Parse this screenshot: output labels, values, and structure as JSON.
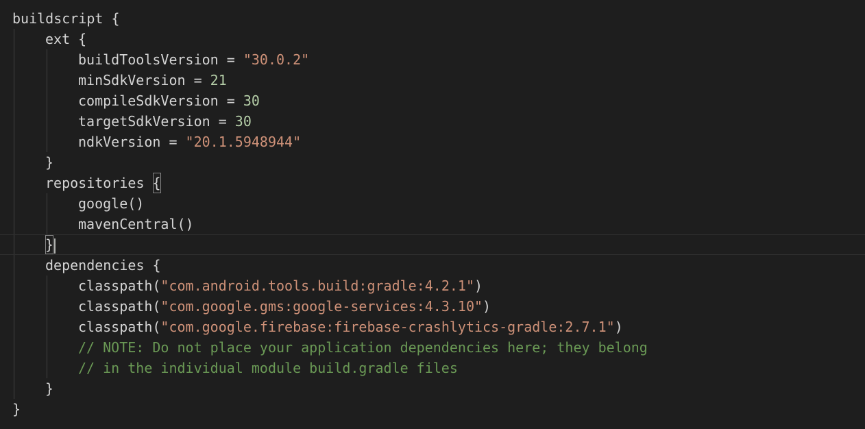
{
  "editor": {
    "lines": [
      {
        "id": "l1",
        "tokens": [
          {
            "t": "buildscript {",
            "k": "plain"
          }
        ]
      },
      {
        "id": "l2",
        "tokens": [
          {
            "t": "ext {",
            "k": "plain"
          }
        ]
      },
      {
        "id": "l3",
        "tokens": [
          {
            "t": "buildToolsVersion = ",
            "k": "plain"
          },
          {
            "t": "\"30.0.2\"",
            "k": "str"
          }
        ]
      },
      {
        "id": "l4",
        "tokens": [
          {
            "t": "minSdkVersion = ",
            "k": "plain"
          },
          {
            "t": "21",
            "k": "num"
          }
        ]
      },
      {
        "id": "l5",
        "tokens": [
          {
            "t": "compileSdkVersion = ",
            "k": "plain"
          },
          {
            "t": "30",
            "k": "num"
          }
        ]
      },
      {
        "id": "l6",
        "tokens": [
          {
            "t": "targetSdkVersion = ",
            "k": "plain"
          },
          {
            "t": "30",
            "k": "num"
          }
        ]
      },
      {
        "id": "l7",
        "tokens": [
          {
            "t": "ndkVersion = ",
            "k": "plain"
          },
          {
            "t": "\"20.1.5948944\"",
            "k": "str"
          }
        ]
      },
      {
        "id": "l8",
        "tokens": [
          {
            "t": "}",
            "k": "plain"
          }
        ]
      },
      {
        "id": "l9",
        "tokens": [
          {
            "t": "repositories ",
            "k": "plain"
          },
          {
            "t": "{",
            "k": "bracket"
          }
        ]
      },
      {
        "id": "l10",
        "tokens": [
          {
            "t": "google()",
            "k": "plain"
          }
        ]
      },
      {
        "id": "l11",
        "tokens": [
          {
            "t": "mavenCentral()",
            "k": "plain"
          }
        ]
      },
      {
        "id": "l12",
        "tokens": [
          {
            "t": "}",
            "k": "bracket"
          }
        ]
      },
      {
        "id": "l13",
        "tokens": [
          {
            "t": "dependencies {",
            "k": "plain"
          }
        ]
      },
      {
        "id": "l14",
        "tokens": [
          {
            "t": "classpath(",
            "k": "plain"
          },
          {
            "t": "\"com.android.tools.build:gradle:4.2.1\"",
            "k": "str"
          },
          {
            "t": ")",
            "k": "plain"
          }
        ]
      },
      {
        "id": "l15",
        "tokens": [
          {
            "t": "classpath(",
            "k": "plain"
          },
          {
            "t": "\"com.google.gms:google-services:4.3.10\"",
            "k": "str"
          },
          {
            "t": ")",
            "k": "plain"
          }
        ]
      },
      {
        "id": "l16",
        "tokens": [
          {
            "t": "classpath(",
            "k": "plain"
          },
          {
            "t": "\"com.google.firebase:firebase-crashlytics-gradle:2.7.1\"",
            "k": "str"
          },
          {
            "t": ")",
            "k": "plain"
          }
        ]
      },
      {
        "id": "l17",
        "tokens": [
          {
            "t": "// NOTE: Do not place your application dependencies here; they belong",
            "k": "cmt"
          }
        ]
      },
      {
        "id": "l18",
        "tokens": [
          {
            "t": "// in the individual module build.gradle files",
            "k": "cmt"
          }
        ]
      },
      {
        "id": "l19",
        "tokens": [
          {
            "t": "}",
            "k": "plain"
          }
        ]
      },
      {
        "id": "l20",
        "tokens": [
          {
            "t": "}",
            "k": "plain"
          }
        ]
      }
    ]
  },
  "colors": {
    "background": "#1e1e1e",
    "text": "#d4d4d4",
    "string": "#ce9178",
    "number": "#b5cea8",
    "comment": "#6a9955",
    "indent_guide": "#404040"
  }
}
